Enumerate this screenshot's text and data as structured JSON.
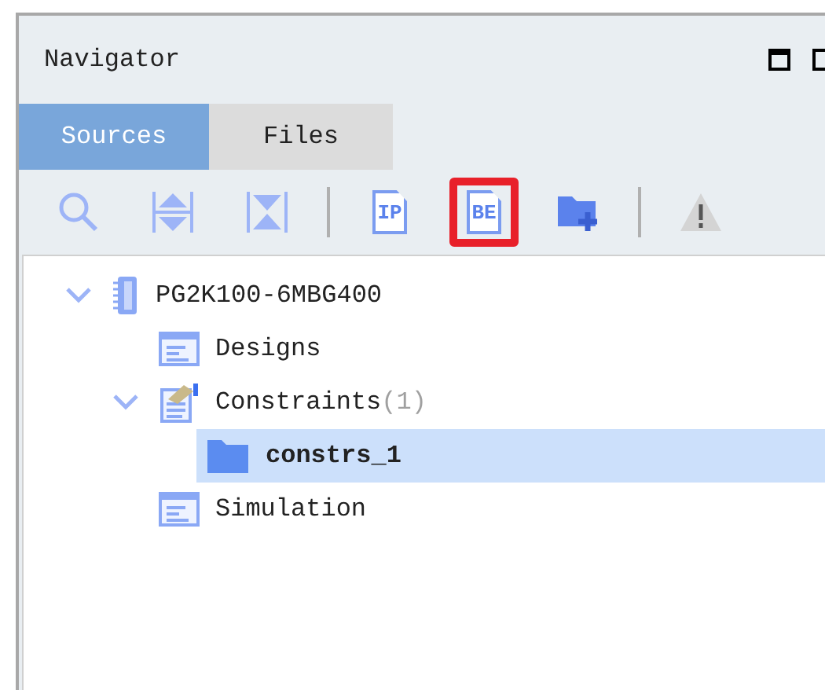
{
  "panel": {
    "title": "Navigator"
  },
  "tabs": [
    {
      "label": "Sources",
      "selected": true
    },
    {
      "label": "Files",
      "selected": false
    }
  ],
  "toolbar": [
    {
      "kind": "search",
      "highlighted": false
    },
    {
      "kind": "expand",
      "highlighted": false
    },
    {
      "kind": "collapse",
      "highlighted": false
    },
    {
      "kind": "separator"
    },
    {
      "kind": "ip",
      "label": "IP",
      "highlighted": false
    },
    {
      "kind": "be",
      "label": "BE",
      "highlighted": true
    },
    {
      "kind": "add-folder",
      "highlighted": false
    },
    {
      "kind": "separator"
    },
    {
      "kind": "warning",
      "highlighted": false
    }
  ],
  "tree": [
    {
      "kind": "chip",
      "label": "PG2K100-6MBG400",
      "expanded": true,
      "selected": false,
      "children": [
        {
          "kind": "list",
          "label": "Designs",
          "selected": false
        },
        {
          "kind": "constraints",
          "label": "Constraints",
          "count": "(1)",
          "expanded": true,
          "selected": false,
          "children": [
            {
              "kind": "folder",
              "label": "constrs_1",
              "selected": true
            }
          ]
        },
        {
          "kind": "list",
          "label": "Simulation",
          "selected": false
        }
      ]
    }
  ]
}
